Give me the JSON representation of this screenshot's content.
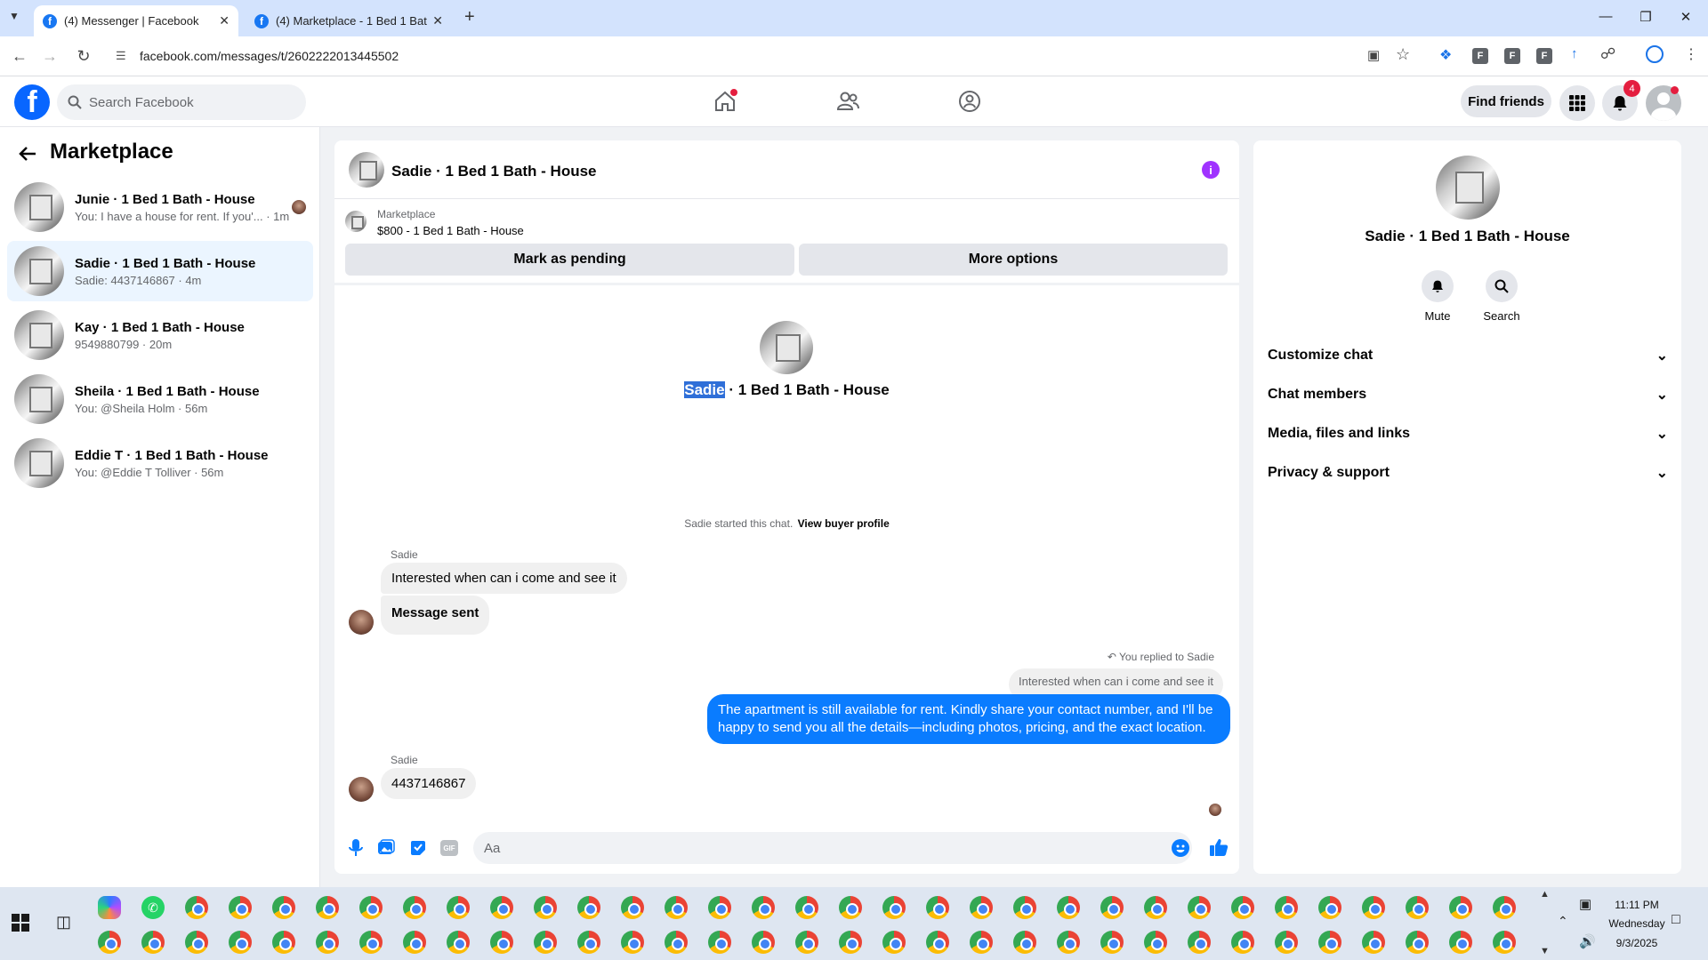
{
  "browser": {
    "tabs": [
      {
        "title": "(4) Messenger | Facebook"
      },
      {
        "title": "(4) Marketplace - 1 Bed 1 Bath"
      }
    ],
    "url": "facebook.com/messages/t/2602222013445502"
  },
  "header": {
    "search_placeholder": "Search Facebook",
    "find_friends": "Find friends",
    "notif_count": "4"
  },
  "sidebar": {
    "title": "Marketplace",
    "conversations": [
      {
        "name": "Junie · 1 Bed 1 Bath - House",
        "preview": "You: I have a house for rent. If you'... · 1m"
      },
      {
        "name": "Sadie · 1 Bed 1 Bath - House",
        "preview": "Sadie: 4437146867 · 4m"
      },
      {
        "name": "Kay · 1 Bed 1 Bath - House",
        "preview": "9549880799 · 20m"
      },
      {
        "name": "Sheila · 1 Bed 1 Bath - House",
        "preview": "You: @Sheila Holm · 56m"
      },
      {
        "name": "Eddie T · 1 Bed 1 Bath - House",
        "preview": "You: @Eddie T Tolliver · 56m"
      }
    ]
  },
  "chat": {
    "title": "Sadie · 1 Bed 1 Bath - House",
    "listing_label": "Marketplace",
    "listing_detail": "$800 - 1 Bed 1 Bath - House",
    "mark_pending": "Mark as pending",
    "more_options": "More options",
    "hero_name_highlight": "Sadie",
    "hero_name_rest": " · 1 Bed 1 Bath - House",
    "started_text": "Sadie started this chat.",
    "view_profile": "View buyer profile",
    "sender": "Sadie",
    "msg1": "Interested when can i come and see it",
    "msg2": "Message sent",
    "replied_to": "You replied to Sadie",
    "quoted": "Interested when can i come and see it",
    "my_msg_line1": "The apartment is still available for rent. Kindly share your contact number, and I'll be",
    "my_msg_line2": "happy to send you all the details—including photos, pricing, and the exact location.",
    "sender2": "Sadie",
    "msg3": "4437146867",
    "composer_placeholder": "Aa"
  },
  "details": {
    "name": "Sadie · 1 Bed 1 Bath - House",
    "mute": "Mute",
    "search": "Search",
    "sections": [
      "Customize chat",
      "Chat members",
      "Media, files and links",
      "Privacy & support"
    ]
  },
  "taskbar": {
    "time": "11:11 PM",
    "day": "Wednesday",
    "date": "9/3/2025"
  },
  "colors": {
    "brand": "#0866ff",
    "bubble_mine": "#0a7cff",
    "selected_row": "#ebf5ff"
  }
}
